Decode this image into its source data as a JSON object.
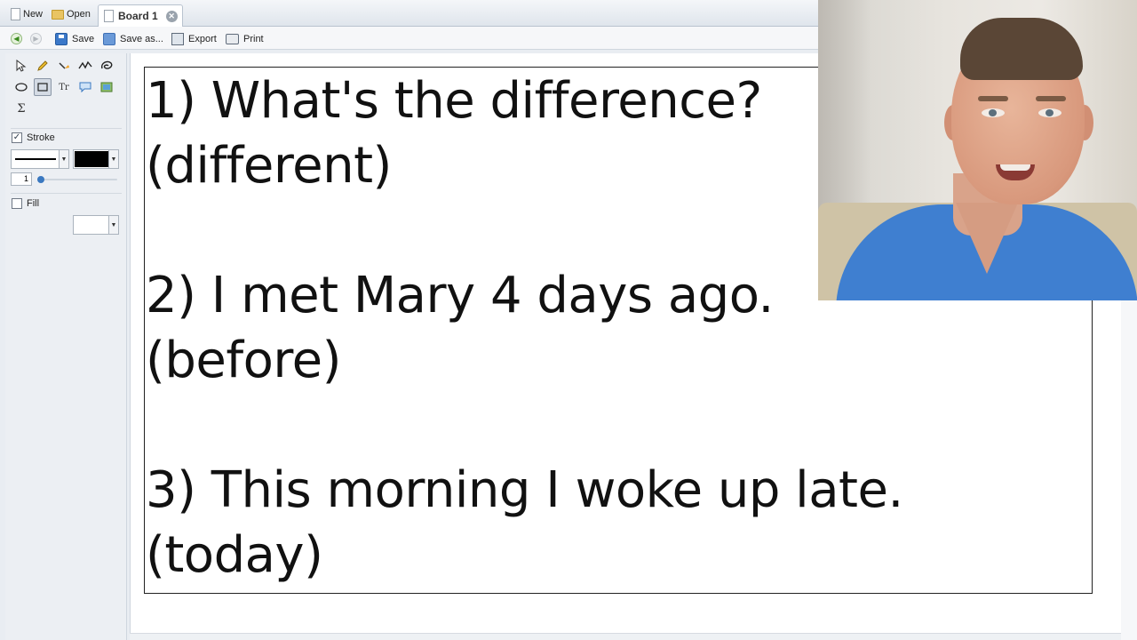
{
  "tabbar": {
    "new_label": "New",
    "open_label": "Open",
    "tab_title": "Board 1"
  },
  "toolbar": {
    "save_label": "Save",
    "save_as_label": "Save as...",
    "export_label": "Export",
    "print_label": "Print"
  },
  "sidebar": {
    "stroke_label": "Stroke",
    "stroke_checked": true,
    "stroke_width": "1",
    "stroke_color": "#000000",
    "fill_label": "Fill",
    "fill_checked": false,
    "fill_color": "#ffffff",
    "text_tool_glyph": "Tr",
    "sigma_glyph": "Σ"
  },
  "board": {
    "lines": [
      "1) What's the difference?",
      "(different)",
      "",
      "2) I met Mary 4 days ago.",
      "(before)",
      "",
      "3) This morning I woke up late.",
      "(today)"
    ]
  },
  "icons": [
    "back-icon",
    "forward-icon",
    "save-icon",
    "save-as-icon",
    "export-icon",
    "print-icon",
    "select-icon",
    "pencil-icon",
    "highlighter-icon",
    "freehand-icon",
    "lasso-icon",
    "ellipse-icon",
    "rectangle-icon",
    "text-icon",
    "callout-icon",
    "image-icon",
    "formula-icon"
  ]
}
